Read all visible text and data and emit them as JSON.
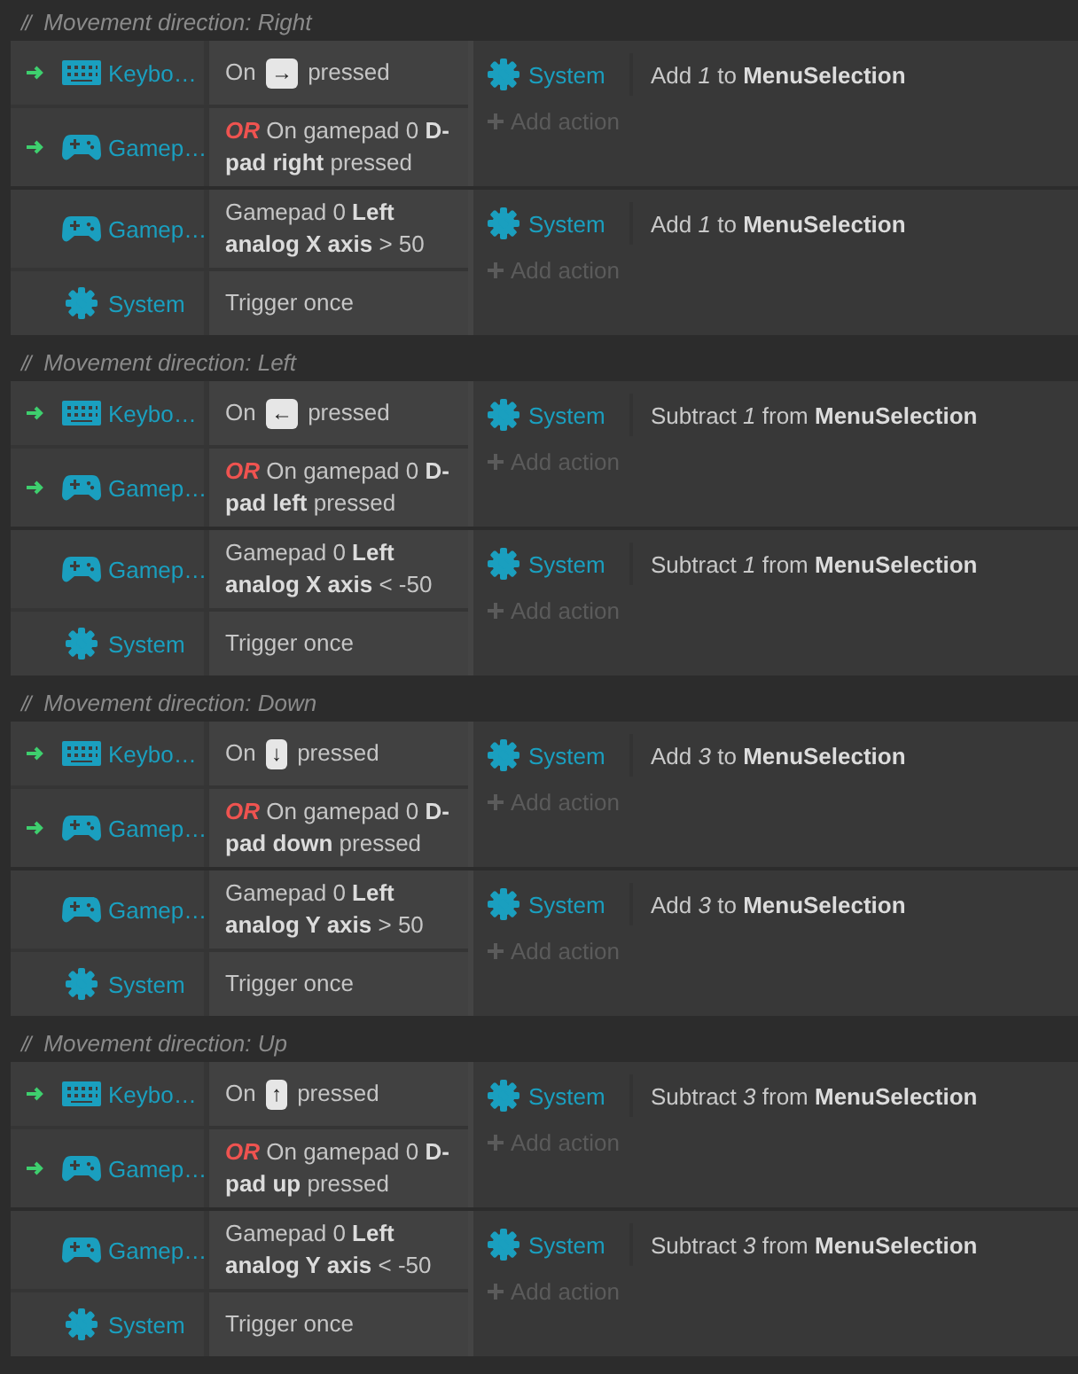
{
  "sections": [
    {
      "marker": "//",
      "comment": "Movement direction: Right",
      "events": [
        {
          "conditions": [
            {
              "kind": "keyboard",
              "in_or": true,
              "object": "Keybo…",
              "parts": [
                {
                  "kind": "text",
                  "text": "On"
                },
                {
                  "kind": "key",
                  "text": "→"
                },
                {
                  "kind": "text",
                  "text": "pressed"
                }
              ]
            },
            {
              "kind": "gamepad",
              "in_or": true,
              "object": "Gamep…",
              "prefix": "OR",
              "parts": [
                {
                  "kind": "text",
                  "text": "On gamepad 0 **D-pad right** pressed"
                }
              ]
            }
          ],
          "actions": [
            {
              "kind": "system",
              "object": "System",
              "text": "Add *1* to **MenuSelection**"
            }
          ],
          "add_action": "Add action"
        },
        {
          "conditions": [
            {
              "kind": "gamepad",
              "in_or": false,
              "object": "Gamep…",
              "parts": [
                {
                  "kind": "text",
                  "text": "Gamepad 0 **Left analog X axis** > 50"
                }
              ]
            },
            {
              "kind": "system",
              "in_or": false,
              "object": "System",
              "parts": [
                {
                  "kind": "text",
                  "text": "Trigger once"
                }
              ]
            }
          ],
          "actions": [
            {
              "kind": "system",
              "object": "System",
              "text": "Add *1* to **MenuSelection**"
            }
          ],
          "add_action": "Add action"
        }
      ]
    },
    {
      "marker": "//",
      "comment": "Movement direction: Left",
      "events": [
        {
          "conditions": [
            {
              "kind": "keyboard",
              "in_or": true,
              "object": "Keybo…",
              "parts": [
                {
                  "kind": "text",
                  "text": "On"
                },
                {
                  "kind": "key",
                  "text": "←"
                },
                {
                  "kind": "text",
                  "text": "pressed"
                }
              ]
            },
            {
              "kind": "gamepad",
              "in_or": true,
              "object": "Gamep…",
              "prefix": "OR",
              "parts": [
                {
                  "kind": "text",
                  "text": "On gamepad 0 **D-pad left** pressed"
                }
              ]
            }
          ],
          "actions": [
            {
              "kind": "system",
              "object": "System",
              "text": "Subtract *1* from **MenuSelection**"
            }
          ],
          "add_action": "Add action"
        },
        {
          "conditions": [
            {
              "kind": "gamepad",
              "in_or": false,
              "object": "Gamep…",
              "parts": [
                {
                  "kind": "text",
                  "text": "Gamepad 0 **Left analog X axis** < -50"
                }
              ]
            },
            {
              "kind": "system",
              "in_or": false,
              "object": "System",
              "parts": [
                {
                  "kind": "text",
                  "text": "Trigger once"
                }
              ]
            }
          ],
          "actions": [
            {
              "kind": "system",
              "object": "System",
              "text": "Subtract *1* from **MenuSelection**"
            }
          ],
          "add_action": "Add action"
        }
      ]
    },
    {
      "marker": "//",
      "comment": "Movement direction: Down",
      "events": [
        {
          "conditions": [
            {
              "kind": "keyboard",
              "in_or": true,
              "object": "Keybo…",
              "parts": [
                {
                  "kind": "text",
                  "text": "On"
                },
                {
                  "kind": "key",
                  "text": "↓"
                },
                {
                  "kind": "text",
                  "text": "pressed"
                }
              ]
            },
            {
              "kind": "gamepad",
              "in_or": true,
              "object": "Gamep…",
              "prefix": "OR",
              "parts": [
                {
                  "kind": "text",
                  "text": "On gamepad 0 **D-pad down** pressed"
                }
              ]
            }
          ],
          "actions": [
            {
              "kind": "system",
              "object": "System",
              "text": "Add *3* to **MenuSelection**"
            }
          ],
          "add_action": "Add action"
        },
        {
          "conditions": [
            {
              "kind": "gamepad",
              "in_or": false,
              "object": "Gamep…",
              "parts": [
                {
                  "kind": "text",
                  "text": "Gamepad 0 **Left analog Y axis** > 50"
                }
              ]
            },
            {
              "kind": "system",
              "in_or": false,
              "object": "System",
              "parts": [
                {
                  "kind": "text",
                  "text": "Trigger once"
                }
              ]
            }
          ],
          "actions": [
            {
              "kind": "system",
              "object": "System",
              "text": "Add *3* to **MenuSelection**"
            }
          ],
          "add_action": "Add action"
        }
      ]
    },
    {
      "marker": "//",
      "comment": "Movement direction: Up",
      "events": [
        {
          "conditions": [
            {
              "kind": "keyboard",
              "in_or": true,
              "object": "Keybo…",
              "parts": [
                {
                  "kind": "text",
                  "text": "On"
                },
                {
                  "kind": "key",
                  "text": "↑"
                },
                {
                  "kind": "text",
                  "text": "pressed"
                }
              ]
            },
            {
              "kind": "gamepad",
              "in_or": true,
              "object": "Gamep…",
              "prefix": "OR",
              "parts": [
                {
                  "kind": "text",
                  "text": "On gamepad 0 **D-pad up** pressed"
                }
              ]
            }
          ],
          "actions": [
            {
              "kind": "system",
              "object": "System",
              "text": "Subtract *3* from **MenuSelection**"
            }
          ],
          "add_action": "Add action"
        },
        {
          "conditions": [
            {
              "kind": "gamepad",
              "in_or": false,
              "object": "Gamep…",
              "parts": [
                {
                  "kind": "text",
                  "text": "Gamepad 0 **Left analog Y axis** < -50"
                }
              ]
            },
            {
              "kind": "system",
              "in_or": false,
              "object": "System",
              "parts": [
                {
                  "kind": "text",
                  "text": "Trigger once"
                }
              ]
            }
          ],
          "actions": [
            {
              "kind": "system",
              "object": "System",
              "text": "Subtract *3* from **MenuSelection**"
            }
          ],
          "add_action": "Add action"
        }
      ]
    }
  ]
}
